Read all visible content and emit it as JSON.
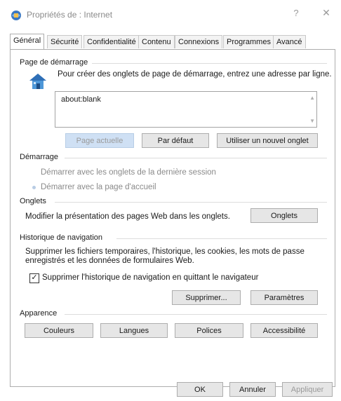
{
  "window": {
    "title": "Propriétés de : Internet",
    "help_glyph": "?",
    "close_glyph": "✕"
  },
  "tabs": [
    {
      "label": "Général",
      "active": true
    },
    {
      "label": "Sécurité"
    },
    {
      "label": "Confidentialité"
    },
    {
      "label": "Contenu"
    },
    {
      "label": "Connexions"
    },
    {
      "label": "Programmes"
    },
    {
      "label": "Avancé"
    }
  ],
  "homepage": {
    "heading": "Page de démarrage",
    "description": "Pour créer des onglets de page de démarrage, entrez une adresse par ligne.",
    "url_value": "about:blank",
    "icon": "house-icon",
    "btn_current": "Page actuelle",
    "btn_default": "Par défaut",
    "btn_new_tab": "Utiliser un nouvel onglet"
  },
  "startup": {
    "heading": "Démarrage",
    "option_last_session": "Démarrer avec les onglets de la dernière session",
    "option_home_page": "Démarrer avec la page d'accueil",
    "selected": "home_page"
  },
  "tabs_group": {
    "heading": "Onglets",
    "description": "Modifier la présentation des pages Web dans les onglets.",
    "button": "Onglets"
  },
  "history": {
    "heading": "Historique de navigation",
    "description_line1": "Supprimer les fichiers temporaires, l'historique, les cookies, les mots de passe",
    "description_line2": "enregistrés et les données de formulaires Web.",
    "checkbox_label": "Supprimer l'historique de navigation en quittant le navigateur",
    "checkbox_checked": true,
    "checkmark": "✓",
    "btn_delete": "Supprimer...",
    "btn_settings": "Paramètres"
  },
  "appearance": {
    "heading": "Apparence",
    "btn_colors": "Couleurs",
    "btn_languages": "Langues",
    "btn_fonts": "Polices",
    "btn_accessibility": "Accessibilité"
  },
  "footer": {
    "ok": "OK",
    "cancel": "Annuler",
    "apply": "Appliquer"
  },
  "colors": {
    "disabled_button_bg": "#cfe0f4",
    "panel_border": "#adadad"
  }
}
